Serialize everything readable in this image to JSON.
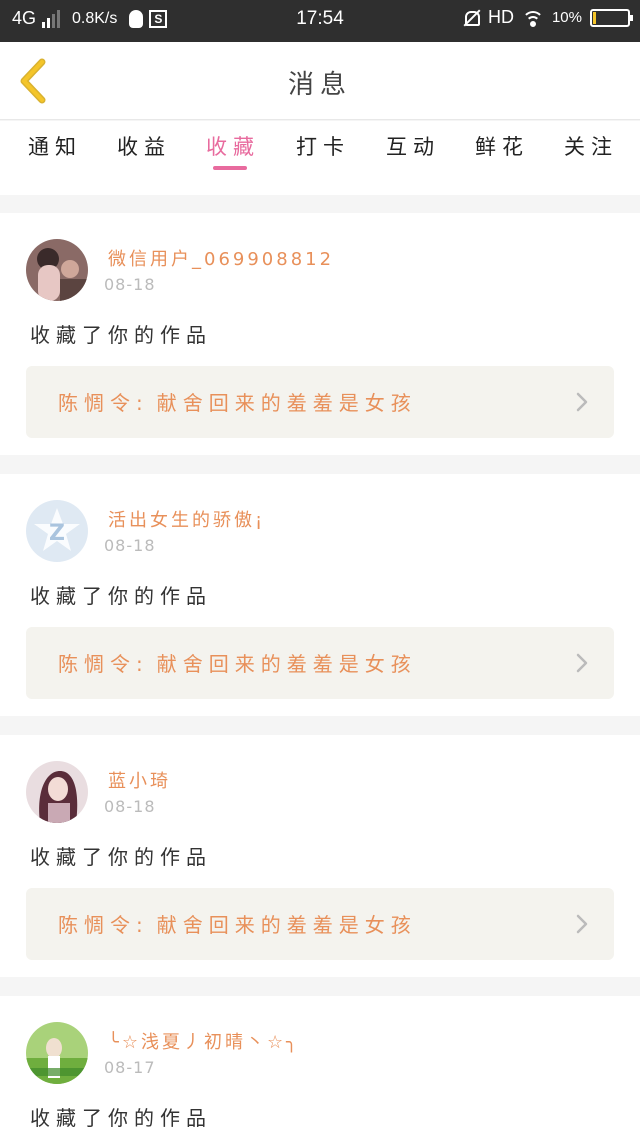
{
  "status_bar": {
    "network": "4G",
    "speed": "0.8K/s",
    "time": "17:54",
    "hd": "HD",
    "battery_percent": "10%",
    "battery_level": 0.1,
    "battery_color": "#f4c52a"
  },
  "header": {
    "title": "消息",
    "back_icon": "chevron-left-icon",
    "back_color": "#f4c52a"
  },
  "tabs": [
    {
      "label": "通知",
      "active": false
    },
    {
      "label": "收益",
      "active": false
    },
    {
      "label": "收藏",
      "active": true
    },
    {
      "label": "打卡",
      "active": false
    },
    {
      "label": "互动",
      "active": false
    },
    {
      "label": "鲜花",
      "active": false
    },
    {
      "label": "关注",
      "active": false
    }
  ],
  "accent_color": "#e86b9e",
  "name_color": "#e8905a",
  "messages": [
    {
      "username": "微信用户_069908812",
      "date": "08-18",
      "action": "收藏了你的作品",
      "work_author": "陈惆令:",
      "work_title": "献舍回来的羞羞是女孩"
    },
    {
      "username": "活出女生的骄傲¡",
      "date": "08-18",
      "action": "收藏了你的作品",
      "work_author": "陈惆令:",
      "work_title": "献舍回来的羞羞是女孩"
    },
    {
      "username": "蓝小琦",
      "date": "08-18",
      "action": "收藏了你的作品",
      "work_author": "陈惆令:",
      "work_title": "献舍回来的羞羞是女孩"
    },
    {
      "username": "╰☆浅夏丿初晴丶☆╮",
      "date": "08-17",
      "action": "收藏了你的作品"
    }
  ]
}
